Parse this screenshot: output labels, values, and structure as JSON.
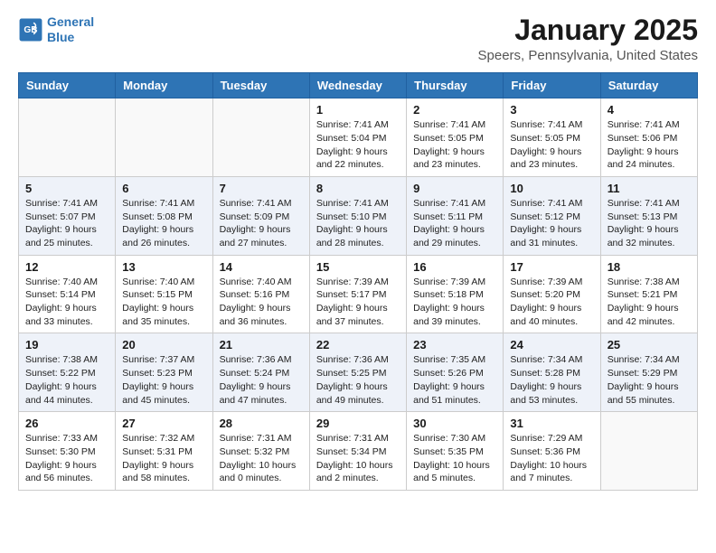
{
  "header": {
    "logo_line1": "General",
    "logo_line2": "Blue",
    "title": "January 2025",
    "subtitle": "Speers, Pennsylvania, United States"
  },
  "weekdays": [
    "Sunday",
    "Monday",
    "Tuesday",
    "Wednesday",
    "Thursday",
    "Friday",
    "Saturday"
  ],
  "weeks": [
    [
      {
        "day": "",
        "info": ""
      },
      {
        "day": "",
        "info": ""
      },
      {
        "day": "",
        "info": ""
      },
      {
        "day": "1",
        "info": "Sunrise: 7:41 AM\nSunset: 5:04 PM\nDaylight: 9 hours and 22 minutes."
      },
      {
        "day": "2",
        "info": "Sunrise: 7:41 AM\nSunset: 5:05 PM\nDaylight: 9 hours and 23 minutes."
      },
      {
        "day": "3",
        "info": "Sunrise: 7:41 AM\nSunset: 5:05 PM\nDaylight: 9 hours and 23 minutes."
      },
      {
        "day": "4",
        "info": "Sunrise: 7:41 AM\nSunset: 5:06 PM\nDaylight: 9 hours and 24 minutes."
      }
    ],
    [
      {
        "day": "5",
        "info": "Sunrise: 7:41 AM\nSunset: 5:07 PM\nDaylight: 9 hours and 25 minutes."
      },
      {
        "day": "6",
        "info": "Sunrise: 7:41 AM\nSunset: 5:08 PM\nDaylight: 9 hours and 26 minutes."
      },
      {
        "day": "7",
        "info": "Sunrise: 7:41 AM\nSunset: 5:09 PM\nDaylight: 9 hours and 27 minutes."
      },
      {
        "day": "8",
        "info": "Sunrise: 7:41 AM\nSunset: 5:10 PM\nDaylight: 9 hours and 28 minutes."
      },
      {
        "day": "9",
        "info": "Sunrise: 7:41 AM\nSunset: 5:11 PM\nDaylight: 9 hours and 29 minutes."
      },
      {
        "day": "10",
        "info": "Sunrise: 7:41 AM\nSunset: 5:12 PM\nDaylight: 9 hours and 31 minutes."
      },
      {
        "day": "11",
        "info": "Sunrise: 7:41 AM\nSunset: 5:13 PM\nDaylight: 9 hours and 32 minutes."
      }
    ],
    [
      {
        "day": "12",
        "info": "Sunrise: 7:40 AM\nSunset: 5:14 PM\nDaylight: 9 hours and 33 minutes."
      },
      {
        "day": "13",
        "info": "Sunrise: 7:40 AM\nSunset: 5:15 PM\nDaylight: 9 hours and 35 minutes."
      },
      {
        "day": "14",
        "info": "Sunrise: 7:40 AM\nSunset: 5:16 PM\nDaylight: 9 hours and 36 minutes."
      },
      {
        "day": "15",
        "info": "Sunrise: 7:39 AM\nSunset: 5:17 PM\nDaylight: 9 hours and 37 minutes."
      },
      {
        "day": "16",
        "info": "Sunrise: 7:39 AM\nSunset: 5:18 PM\nDaylight: 9 hours and 39 minutes."
      },
      {
        "day": "17",
        "info": "Sunrise: 7:39 AM\nSunset: 5:20 PM\nDaylight: 9 hours and 40 minutes."
      },
      {
        "day": "18",
        "info": "Sunrise: 7:38 AM\nSunset: 5:21 PM\nDaylight: 9 hours and 42 minutes."
      }
    ],
    [
      {
        "day": "19",
        "info": "Sunrise: 7:38 AM\nSunset: 5:22 PM\nDaylight: 9 hours and 44 minutes."
      },
      {
        "day": "20",
        "info": "Sunrise: 7:37 AM\nSunset: 5:23 PM\nDaylight: 9 hours and 45 minutes."
      },
      {
        "day": "21",
        "info": "Sunrise: 7:36 AM\nSunset: 5:24 PM\nDaylight: 9 hours and 47 minutes."
      },
      {
        "day": "22",
        "info": "Sunrise: 7:36 AM\nSunset: 5:25 PM\nDaylight: 9 hours and 49 minutes."
      },
      {
        "day": "23",
        "info": "Sunrise: 7:35 AM\nSunset: 5:26 PM\nDaylight: 9 hours and 51 minutes."
      },
      {
        "day": "24",
        "info": "Sunrise: 7:34 AM\nSunset: 5:28 PM\nDaylight: 9 hours and 53 minutes."
      },
      {
        "day": "25",
        "info": "Sunrise: 7:34 AM\nSunset: 5:29 PM\nDaylight: 9 hours and 55 minutes."
      }
    ],
    [
      {
        "day": "26",
        "info": "Sunrise: 7:33 AM\nSunset: 5:30 PM\nDaylight: 9 hours and 56 minutes."
      },
      {
        "day": "27",
        "info": "Sunrise: 7:32 AM\nSunset: 5:31 PM\nDaylight: 9 hours and 58 minutes."
      },
      {
        "day": "28",
        "info": "Sunrise: 7:31 AM\nSunset: 5:32 PM\nDaylight: 10 hours and 0 minutes."
      },
      {
        "day": "29",
        "info": "Sunrise: 7:31 AM\nSunset: 5:34 PM\nDaylight: 10 hours and 2 minutes."
      },
      {
        "day": "30",
        "info": "Sunrise: 7:30 AM\nSunset: 5:35 PM\nDaylight: 10 hours and 5 minutes."
      },
      {
        "day": "31",
        "info": "Sunrise: 7:29 AM\nSunset: 5:36 PM\nDaylight: 10 hours and 7 minutes."
      },
      {
        "day": "",
        "info": ""
      }
    ]
  ]
}
